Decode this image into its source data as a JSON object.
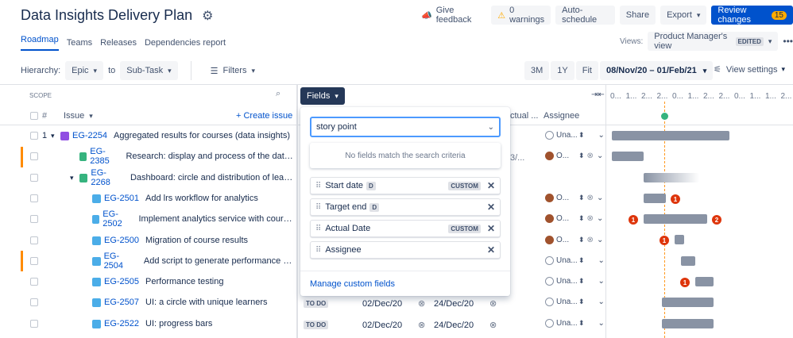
{
  "header": {
    "title": "Data Insights Delivery Plan",
    "feedback": "Give feedback",
    "warnings": "0 warnings",
    "auto_schedule": "Auto-schedule",
    "share": "Share",
    "export": "Export",
    "review": "Review changes",
    "review_count": "15"
  },
  "nav": {
    "tabs": [
      "Roadmap",
      "Teams",
      "Releases",
      "Dependencies report"
    ],
    "views_label": "Views:",
    "view_name": "Product Manager's view",
    "view_badge": "EDITED"
  },
  "toolbar": {
    "hierarchy_label": "Hierarchy:",
    "from": "Epic",
    "to_label": "to",
    "to": "Sub-Task",
    "filters": "Filters",
    "zoom": [
      "3M",
      "1Y",
      "Fit"
    ],
    "date_range": "08/Nov/20 – 01/Feb/21",
    "view_settings": "View settings"
  },
  "scope": {
    "label": "SCOPE",
    "hash": "#",
    "issue_col": "Issue",
    "create_issue": "+ Create issue",
    "rows": [
      {
        "num": "1",
        "key": "EG-2254",
        "summary": "Aggregated results for courses (data insights)",
        "type": "epic"
      },
      {
        "key": "EG-2385",
        "summary": "Research: display and process of the data for Insi...",
        "type": "story"
      },
      {
        "key": "EG-2268",
        "summary": "Dashboard: circle and distribution of learners",
        "type": "story"
      },
      {
        "key": "EG-2501",
        "summary": "Add lrs workflow for analytics",
        "type": "sub"
      },
      {
        "key": "EG-2502",
        "summary": "Implement analytics service with course analy...",
        "type": "sub"
      },
      {
        "key": "EG-2500",
        "summary": "Migration of course results",
        "type": "sub"
      },
      {
        "key": "EG-2504",
        "summary": "Add script to generate performance data",
        "type": "sub"
      },
      {
        "key": "EG-2505",
        "summary": "Performance testing",
        "type": "sub"
      },
      {
        "key": "EG-2507",
        "summary": "UI: a circle with unique learners",
        "type": "sub"
      },
      {
        "key": "EG-2522",
        "summary": "UI: progress bars",
        "type": "sub"
      }
    ]
  },
  "fields": {
    "button": "Fields",
    "search_value": "story point",
    "no_match": "No fields match the search criteria",
    "items": [
      {
        "label": "Start date",
        "badge": "D",
        "custom": "CUSTOM"
      },
      {
        "label": "Target end",
        "badge": "D",
        "custom": ""
      },
      {
        "label": "Actual Date",
        "badge": "",
        "custom": "CUSTOM"
      },
      {
        "label": "Assignee",
        "badge": "",
        "custom": ""
      }
    ],
    "manage": "Manage custom fields"
  },
  "columns": {
    "actual": "ctual ...",
    "assignee": "Assignee",
    "row1_extra": "3/...",
    "status_todo": "TO DO",
    "row9_start": "02/Dec/20",
    "row9_end": "24/Dec/20",
    "row10_start": "02/Dec/20",
    "row10_end": "24/Dec/20"
  },
  "assignees": [
    "Una...",
    "O...",
    "",
    "O...",
    "O...",
    "O...",
    "Una...",
    "Una...",
    "Una...",
    "Una..."
  ],
  "timeline": {
    "ticks": [
      "0...",
      "1...",
      "2...",
      "2...",
      "0...",
      "1...",
      "2...",
      "2...",
      "0...",
      "1...",
      "1...",
      "2..."
    ],
    "deps": [
      "1",
      "1",
      "2",
      "1",
      "1"
    ]
  }
}
